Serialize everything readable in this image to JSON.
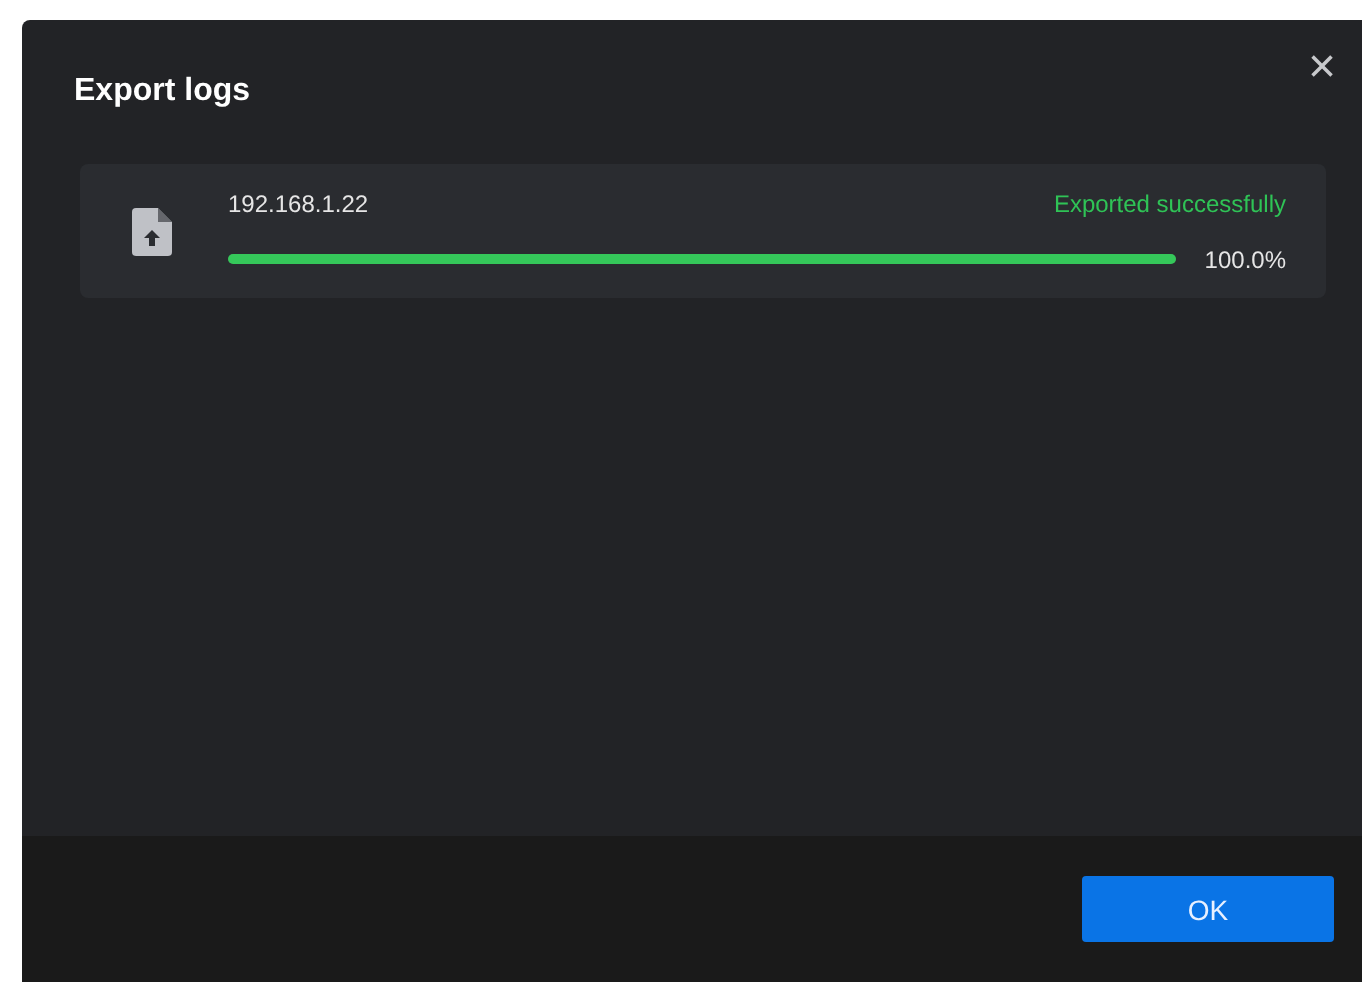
{
  "dialog": {
    "title": "Export logs",
    "close": "×"
  },
  "exports": [
    {
      "host": "192.168.1.22",
      "status": "Exported successfully",
      "level": 1.0,
      "percent": "100.0%"
    }
  ],
  "buttons": [
    {
      "label": "OK",
      "kind": "primary"
    }
  ]
}
